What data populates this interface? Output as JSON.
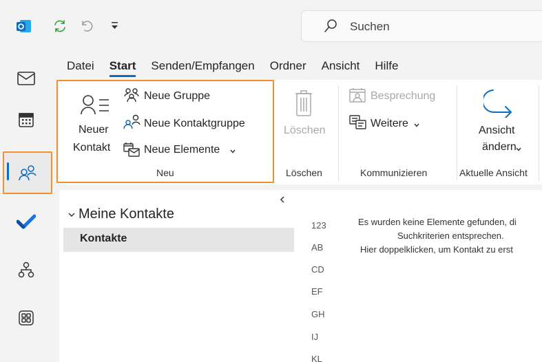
{
  "quick_access": {
    "icons": [
      "outlook-logo-icon",
      "sync-icon",
      "undo-icon",
      "customize-toolbar-icon"
    ]
  },
  "search": {
    "placeholder": "Suchen"
  },
  "rail": {
    "items": [
      "mail-icon",
      "calendar-icon",
      "people-icon",
      "todo-icon",
      "org-explorer-icon",
      "more-apps-icon"
    ],
    "selected": "people-icon"
  },
  "menu": {
    "tabs": [
      "Datei",
      "Start",
      "Senden/Empfangen",
      "Ordner",
      "Ansicht",
      "Hilfe"
    ],
    "active": "Start"
  },
  "ribbon": {
    "new_contact_line1": "Neuer",
    "new_contact_line2": "Kontakt",
    "new_group": "Neue Gruppe",
    "new_contact_group": "Neue Kontaktgruppe",
    "new_items": "Neue Elemente",
    "group_new": "Neu",
    "delete": "Löschen",
    "group_delete": "Löschen",
    "meeting": "Besprechung",
    "more": "Weitere",
    "group_communicate": "Kommunizieren",
    "change_view_line1": "Ansicht",
    "change_view_line2": "ändern",
    "group_current_view": "Aktuelle Ansicht"
  },
  "folders": {
    "header": "Meine Kontakte",
    "items": [
      "Kontakte"
    ]
  },
  "index": [
    "123",
    "AB",
    "CD",
    "EF",
    "GH",
    "IJ",
    "KL"
  ],
  "empty_message": {
    "line1": "Es wurden keine Elemente gefunden, di",
    "line2": "Suchkriterien entsprechen.",
    "line3": "Hier doppelklicken, um Kontakt zu erst"
  },
  "colors": {
    "accent_blue": "#0f6cbd",
    "highlight_orange": "#f0902a",
    "sync_green": "#2e9e3a"
  }
}
